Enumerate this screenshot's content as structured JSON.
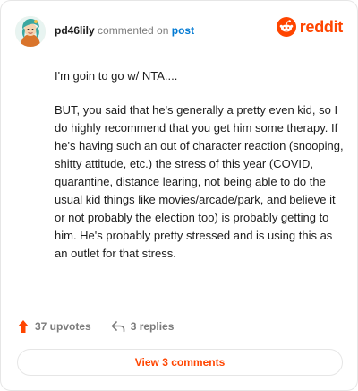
{
  "comment": {
    "username": "pd46lily",
    "verb": "commented on",
    "target": "post",
    "paragraphs": [
      "I'm goin to go w/ NTA....",
      "BUT, you said that he's generally a pretty even kid, so I do highly recommend that you get him some therapy. If he's having such an out of character reaction (snooping, shitty attitude, etc.) the stress of this year (COVID, quarantine, distance learing, not being able to do the usual kid things like movies/arcade/park, and believe it or not probably the election too) is probably getting to him. He's probably pretty stressed and is using this as an outlet for that stress."
    ]
  },
  "brand": {
    "name": "reddit",
    "color": "#ff4500"
  },
  "actions": {
    "upvotes": "37 upvotes",
    "replies": "3 replies"
  },
  "footer": {
    "view_comments": "View 3 comments"
  },
  "icons": {
    "avatar": "avatar",
    "brand": "reddit-logo-icon",
    "upvote": "upvote-arrow-icon",
    "reply": "reply-icon"
  },
  "colors": {
    "accent": "#ff4500",
    "link": "#0079d3",
    "muted": "#7c7c7c",
    "border": "#e6e6e6"
  }
}
